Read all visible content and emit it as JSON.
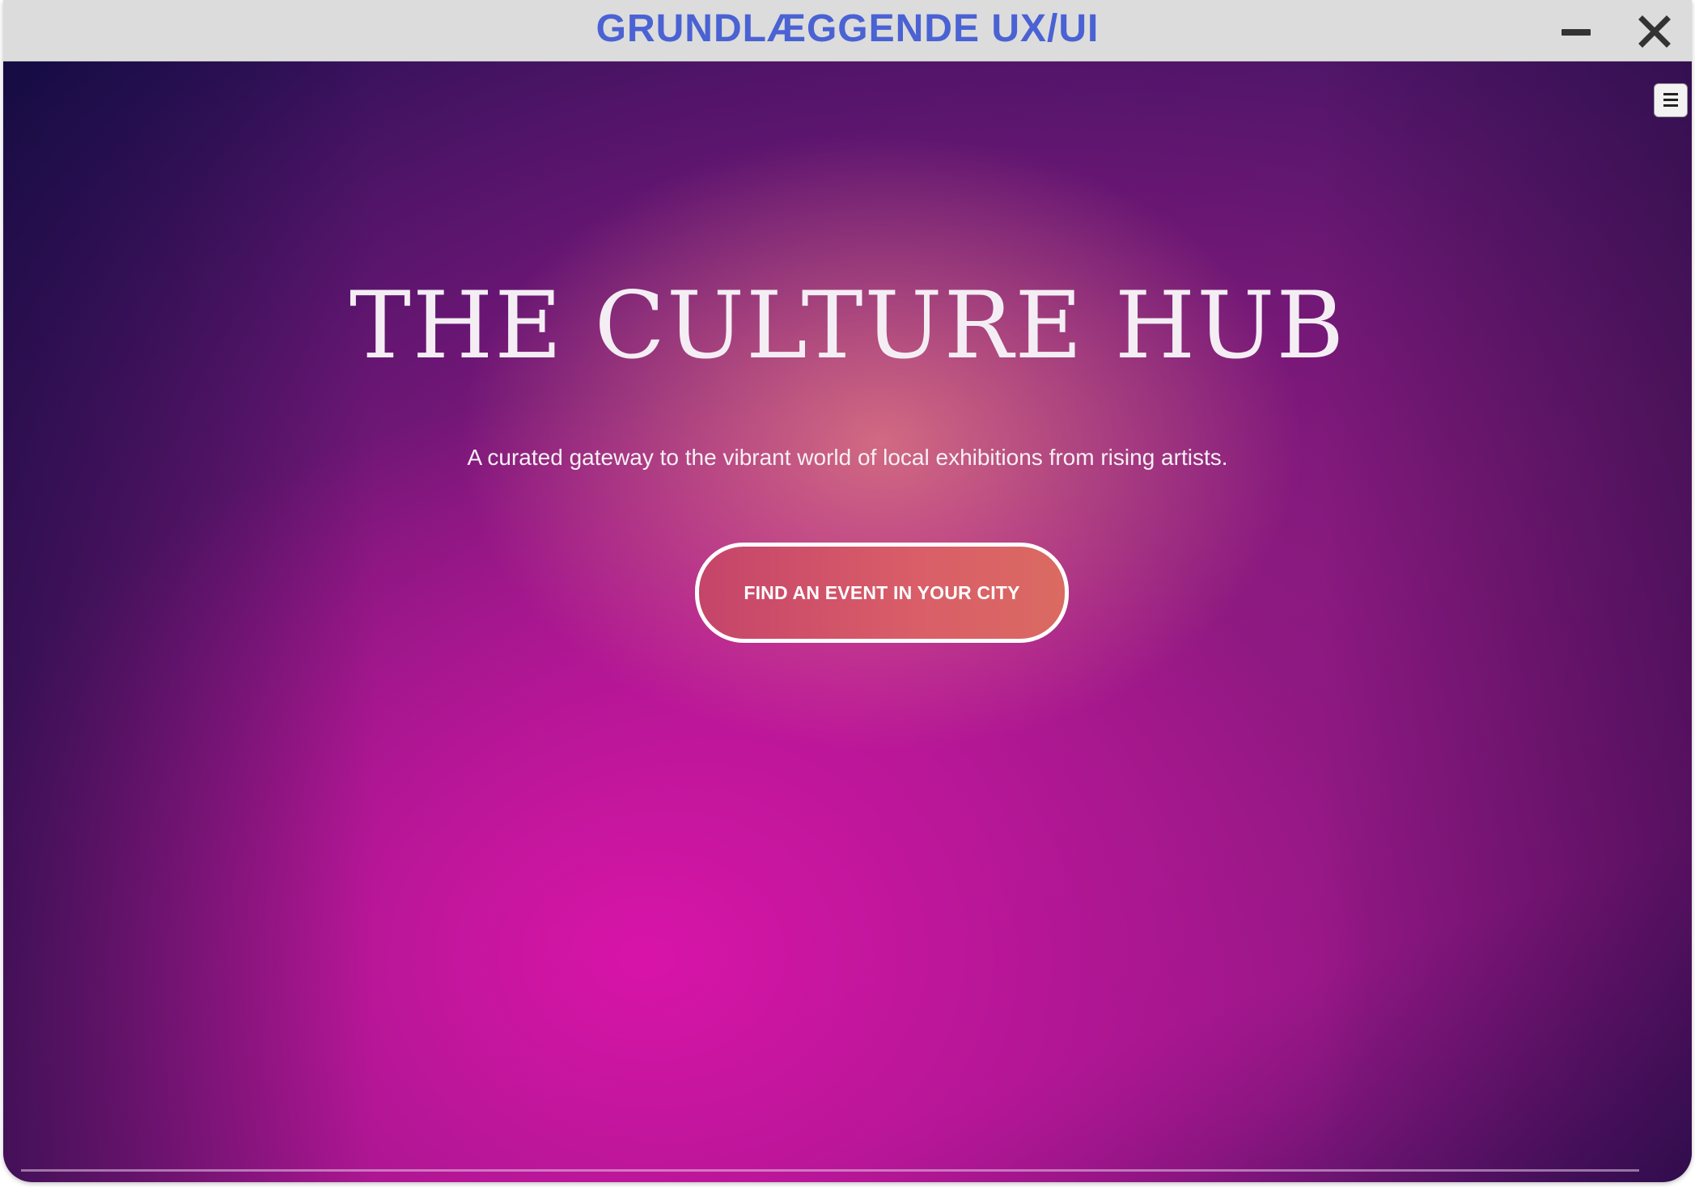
{
  "window": {
    "title": "GRUNDLÆGGENDE UX/UI",
    "minimize_icon": "minimize-icon",
    "close_icon": "close-icon"
  },
  "hero": {
    "menu_icon": "hamburger-menu-icon",
    "title": "THE CULTURE HUB",
    "subtitle": "A curated gateway to the vibrant world of local exhibitions from rising artists.",
    "cta_label": "FIND AN EVENT IN YOUR CITY"
  },
  "colors": {
    "title_accent": "#4a62d3",
    "titlebar_bg": "#dcdcdc",
    "cta_gradient_start": "#c5446a",
    "cta_gradient_end": "#da6a62",
    "cta_border": "#ffffff",
    "hero_dark": "#1a0f4e",
    "hero_magenta": "#dc14aa"
  }
}
